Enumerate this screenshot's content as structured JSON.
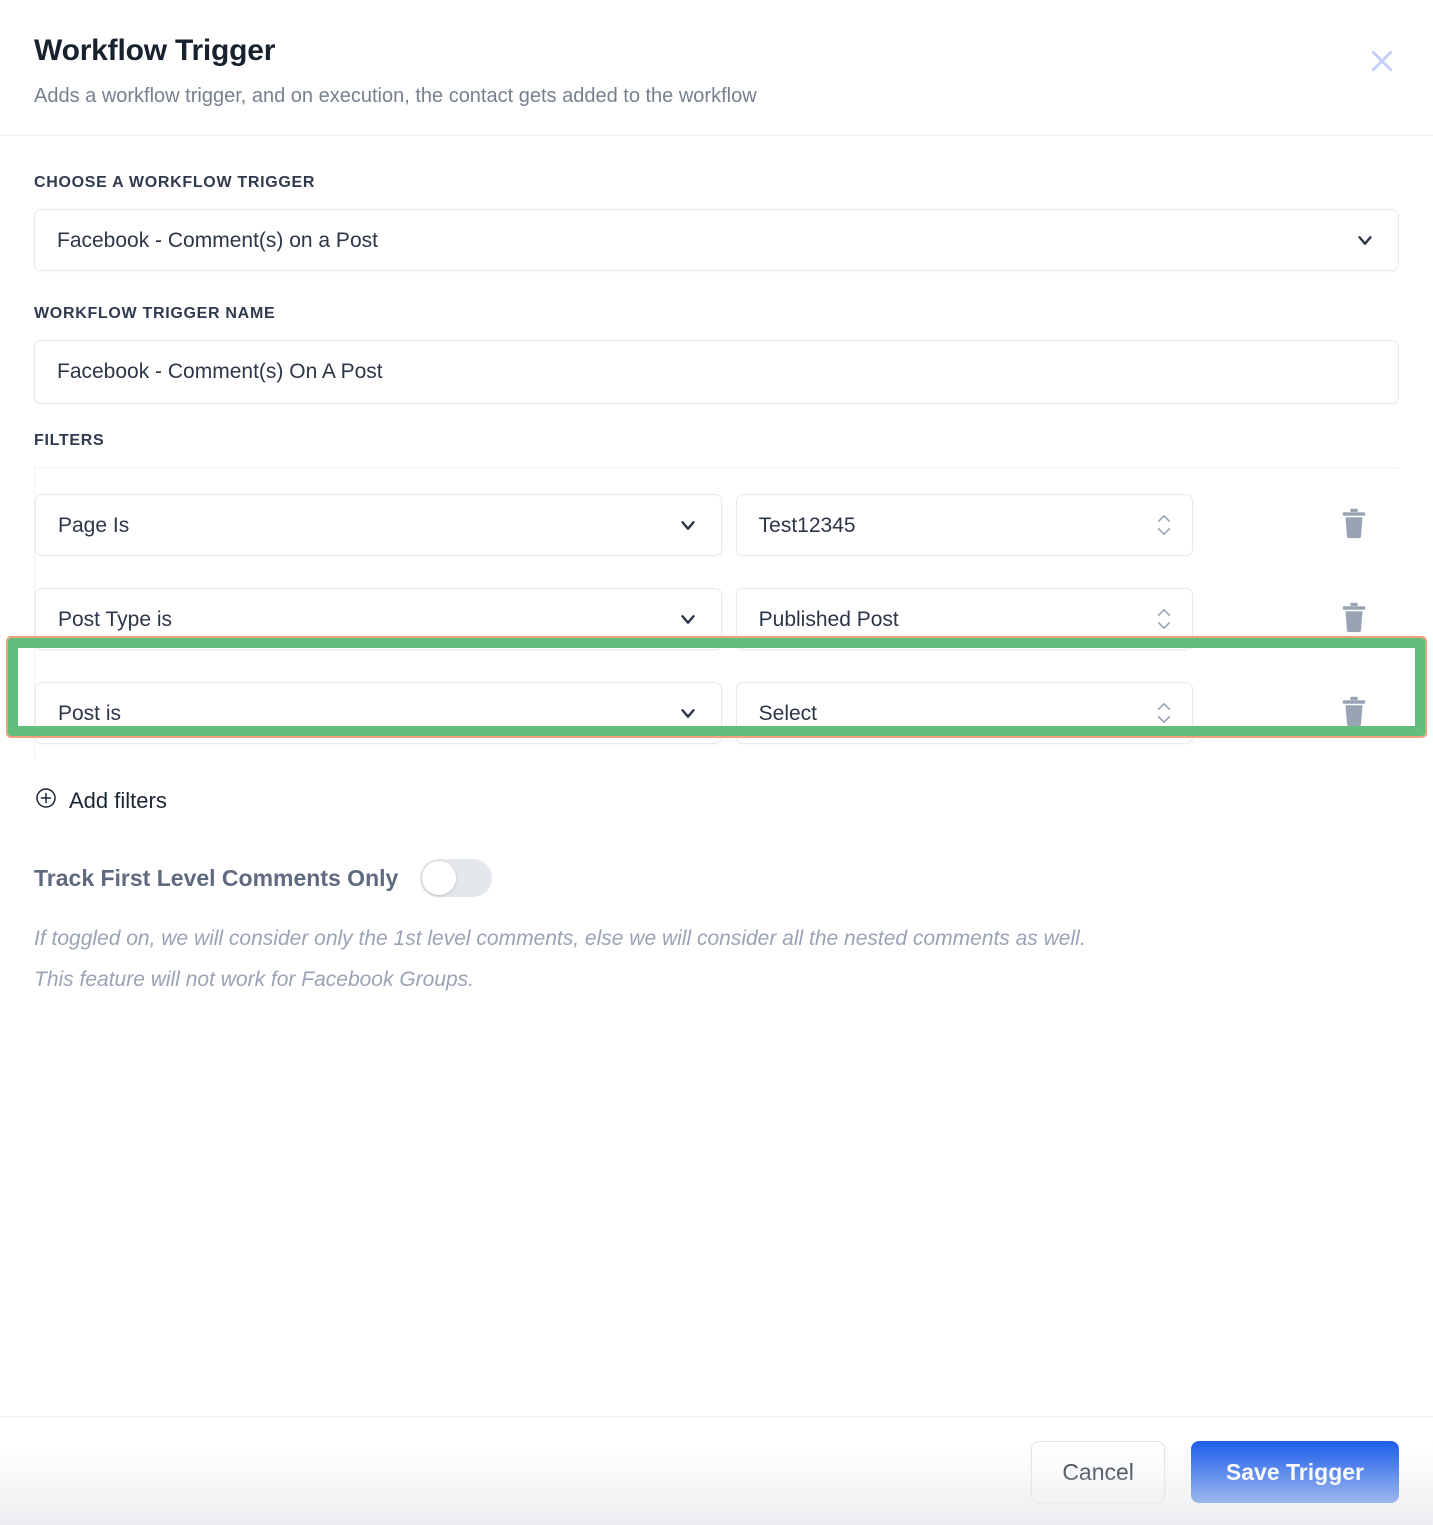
{
  "header": {
    "title": "Workflow Trigger",
    "subtitle": "Adds a workflow trigger, and on execution, the contact gets added to the workflow",
    "close_icon": "close-icon"
  },
  "form": {
    "trigger_select_label": "CHOOSE A WORKFLOW TRIGGER",
    "trigger_select_value": "Facebook - Comment(s) on a Post",
    "trigger_name_label": "WORKFLOW TRIGGER NAME",
    "trigger_name_value": "Facebook - Comment(s) On A Post",
    "trigger_name_placeholder": "Workflow Trigger Name"
  },
  "filters": {
    "label": "FILTERS",
    "rows": [
      {
        "condition": "Page Is",
        "value": "Test12345",
        "delete_icon": "trash-icon",
        "highlighted": false
      },
      {
        "condition": "Post Type is",
        "value": "Published Post",
        "delete_icon": "trash-icon",
        "highlighted": true
      },
      {
        "condition": "Post is",
        "value": "Select",
        "delete_icon": "trash-icon",
        "highlighted": false
      }
    ],
    "add_filters_label": "Add filters",
    "add_filters_icon": "plus-circle-icon"
  },
  "toggle": {
    "label": "Track First Level Comments Only",
    "state": "off",
    "help_line_1": "If toggled on, we will consider only the 1st level comments, else we will consider all the nested comments as well.",
    "help_line_2": "This feature will not work for Facebook Groups."
  },
  "footer": {
    "cancel_label": "Cancel",
    "save_label": "Save Trigger"
  },
  "colors": {
    "primary": "#2563eb",
    "highlight_green": "#63bd7d",
    "highlight_outline": "#f0a080",
    "title": "#18222f",
    "muted": "#76808f"
  }
}
